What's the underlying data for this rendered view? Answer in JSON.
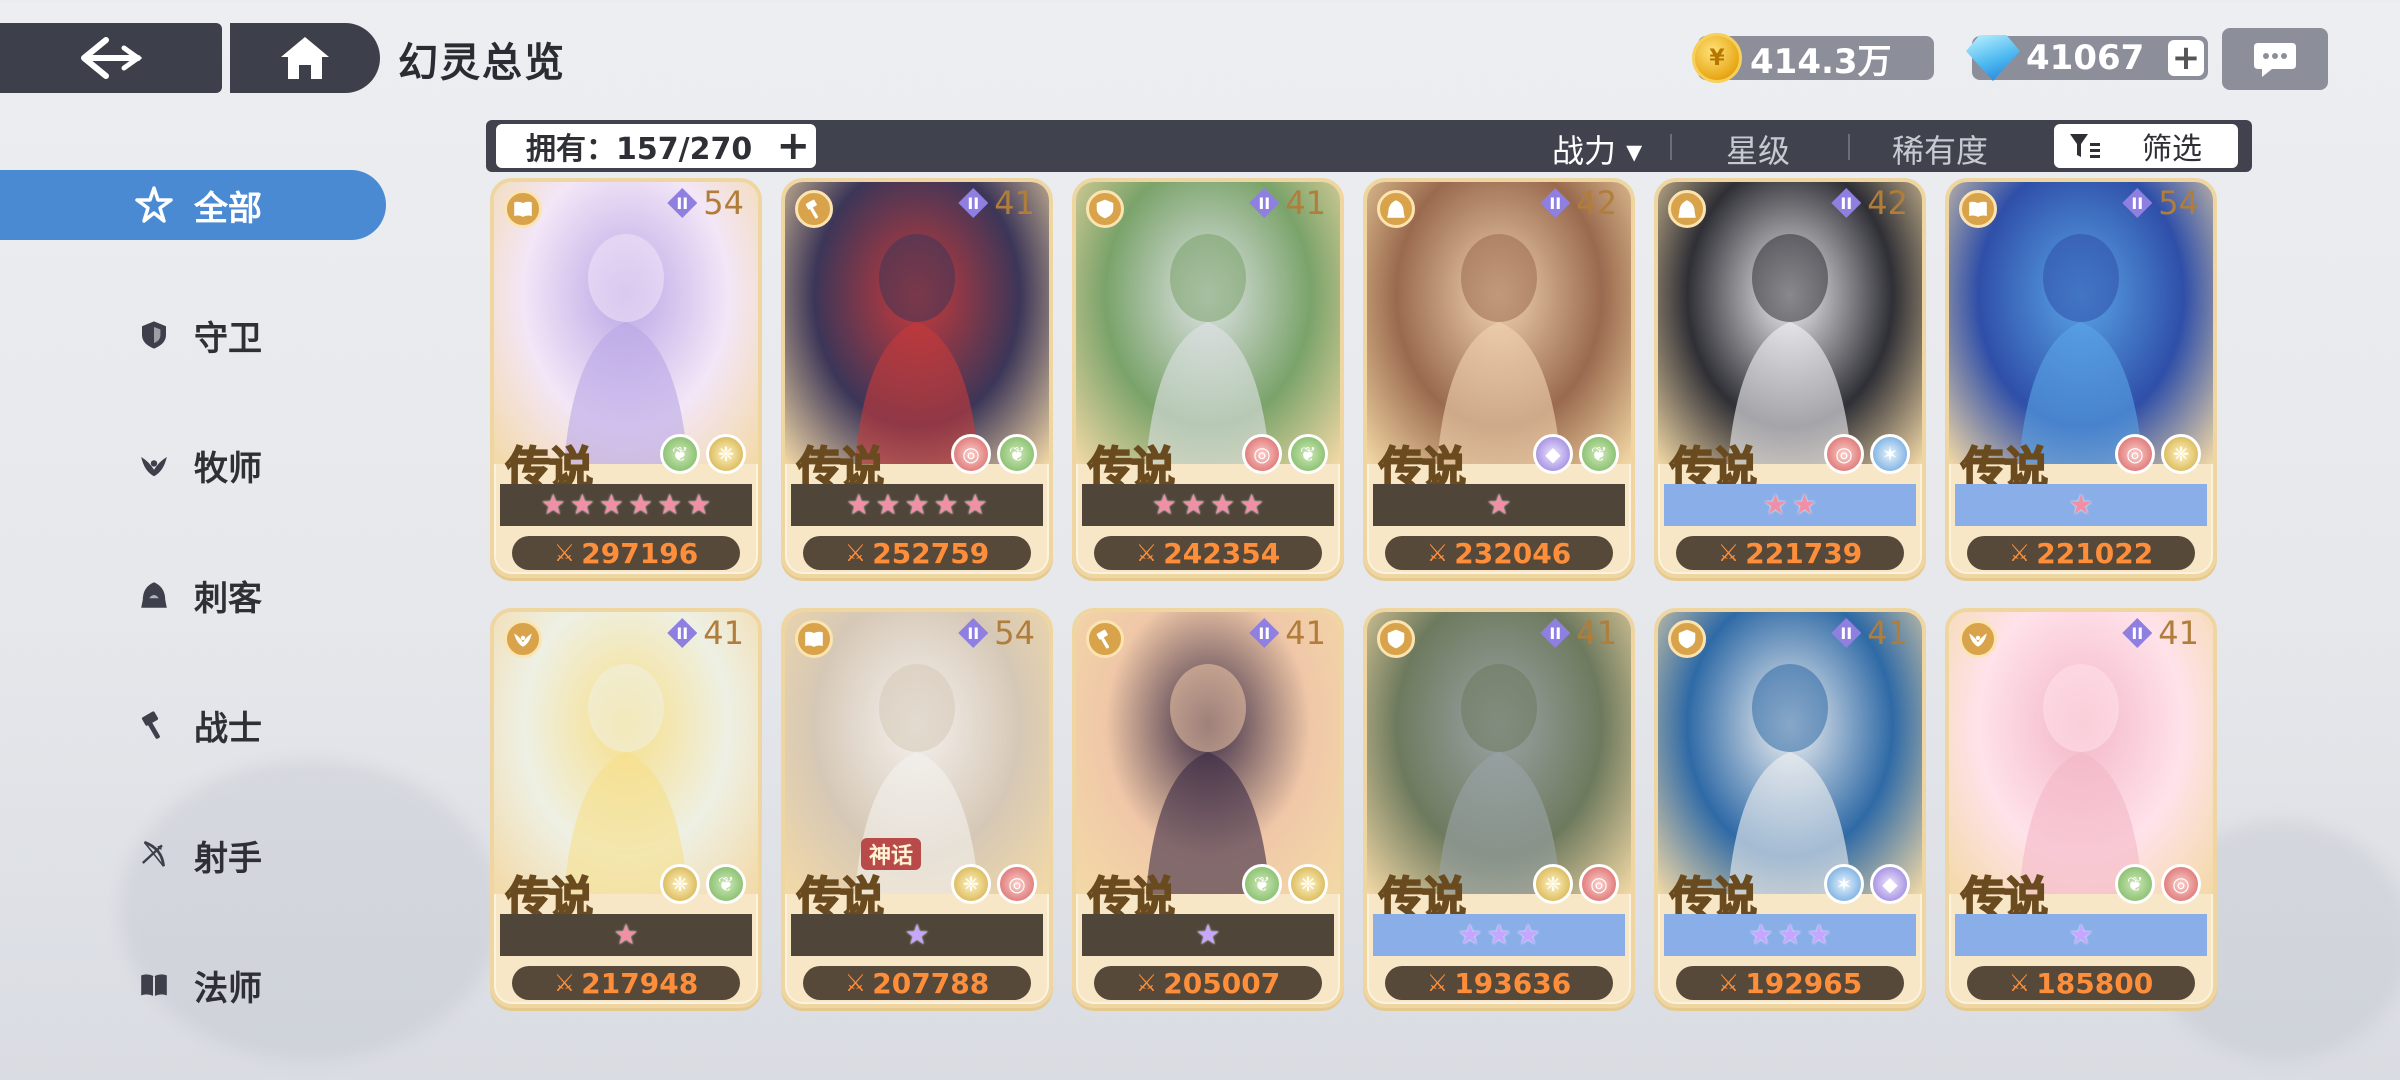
{
  "header": {
    "title": "幻灵总览",
    "gold": "414.3万",
    "gems": "41067",
    "plus": "+"
  },
  "filter_bar": {
    "owned_label": "拥有：157/270",
    "plus": "+",
    "sort_power": "战力 ▾",
    "sort_stars": "星级",
    "sort_rarity": "稀有度",
    "filter_label": "筛选"
  },
  "sidebar": {
    "items": [
      {
        "label": "全部",
        "icon": "swirl-star-icon"
      },
      {
        "label": "守卫",
        "icon": "shield-icon"
      },
      {
        "label": "牧师",
        "icon": "wing-icon"
      },
      {
        "label": "刺客",
        "icon": "hood-icon"
      },
      {
        "label": "战士",
        "icon": "hammer-icon"
      },
      {
        "label": "射手",
        "icon": "bow-icon"
      },
      {
        "label": "法师",
        "icon": "book-icon"
      }
    ]
  },
  "cards": [
    {
      "class_icon": "book-icon",
      "level": "54",
      "rank": "传说",
      "elements": [
        "leaf",
        "wing"
      ],
      "stars": 6,
      "star_color": "pink",
      "band": "dark",
      "power": "297196",
      "art": [
        "#b9a7e6",
        "#f3e6f7"
      ]
    },
    {
      "class_icon": "hammer-icon",
      "level": "41",
      "rank": "传说",
      "elements": [
        "swirl",
        "leaf"
      ],
      "stars": 5,
      "star_color": "pink",
      "band": "dark",
      "power": "252759",
      "art": [
        "#c83a3a",
        "#3c3658"
      ]
    },
    {
      "class_icon": "shield-icon",
      "level": "41",
      "rank": "传说",
      "elements": [
        "swirl",
        "leaf"
      ],
      "stars": 4,
      "star_color": "pink",
      "band": "dark",
      "power": "242354",
      "art": [
        "#dfe3e6",
        "#7aa36a"
      ]
    },
    {
      "class_icon": "hood-icon",
      "level": "42",
      "rank": "传说",
      "elements": [
        "diamond",
        "leaf"
      ],
      "stars": 1,
      "star_color": "pink",
      "band": "dark",
      "power": "232046",
      "art": [
        "#f1d4b0",
        "#9a6a4e"
      ]
    },
    {
      "class_icon": "hood-icon",
      "level": "42",
      "rank": "传说",
      "elements": [
        "swirl",
        "star"
      ],
      "stars": 2,
      "star_color": "pink",
      "band": "blue",
      "power": "221739",
      "art": [
        "#f4f4f6",
        "#2f2f36"
      ]
    },
    {
      "class_icon": "book-icon",
      "level": "54",
      "rank": "传说",
      "elements": [
        "swirl",
        "wing"
      ],
      "stars": 1,
      "star_color": "pink",
      "band": "blue",
      "power": "221022",
      "art": [
        "#5aa5e8",
        "#2f4fa8"
      ]
    },
    {
      "class_icon": "wing-icon",
      "level": "41",
      "rank": "传说",
      "elements": [
        "wing",
        "leaf"
      ],
      "stars": 1,
      "star_color": "pink",
      "band": "dark",
      "power": "217948",
      "art": [
        "#f7df8a",
        "#eef0e4"
      ]
    },
    {
      "class_icon": "book-icon",
      "level": "54",
      "rank": "传说",
      "elements": [
        "wing",
        "swirl"
      ],
      "stars": 1,
      "star_color": "purple",
      "band": "dark",
      "power": "207788",
      "art": [
        "#f4f1ee",
        "#d6c8b6"
      ],
      "tag": "神话"
    },
    {
      "class_icon": "hammer-icon",
      "level": "41",
      "rank": "传说",
      "elements": [
        "leaf",
        "wing"
      ],
      "stars": 1,
      "star_color": "purple",
      "band": "dark",
      "power": "205007",
      "art": [
        "#3a2a44",
        "#f0c8a8"
      ]
    },
    {
      "class_icon": "shield-icon",
      "level": "41",
      "rank": "传说",
      "elements": [
        "wing",
        "swirl"
      ],
      "stars": 3,
      "star_color": "purple",
      "band": "blue",
      "power": "193636",
      "art": [
        "#9aa3a6",
        "#6e7a5e"
      ]
    },
    {
      "class_icon": "shield-icon",
      "level": "41",
      "rank": "传说",
      "elements": [
        "star",
        "diamond"
      ],
      "stars": 3,
      "star_color": "purple",
      "band": "blue",
      "power": "192965",
      "art": [
        "#f2f2f2",
        "#2f6aa6"
      ]
    },
    {
      "class_icon": "wing-icon",
      "level": "41",
      "rank": "传说",
      "elements": [
        "leaf",
        "swirl"
      ],
      "stars": 1,
      "star_color": "purple",
      "band": "blue",
      "power": "185800",
      "art": [
        "#f3b7c7",
        "#ffe2ea"
      ]
    }
  ],
  "colors": {
    "accent": "#4a8ad2",
    "panel": "#3d3f4b",
    "power_text": "#ff8e3a"
  }
}
